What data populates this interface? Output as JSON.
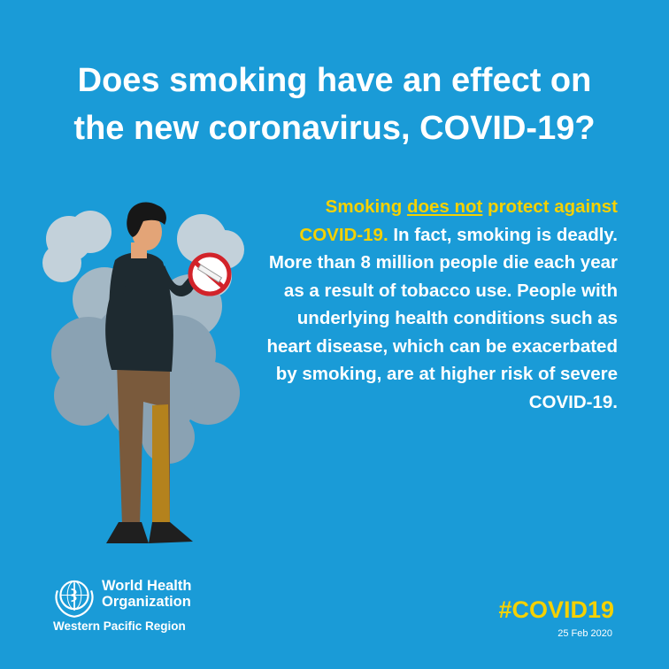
{
  "headline": {
    "line1": "Does smoking have an effect on",
    "line2": "the new coronavirus, COVID-19?"
  },
  "message": {
    "lead_a": "Smoking ",
    "lead_underlined": "does not",
    "lead_b": " protect against COVID-19.",
    "body": " In fact, smoking is deadly. More than 8 million people die each year as a result of tobacco use. People with underlying health conditions such as heart disease, which can be exacerbated by smoking, are at higher risk of severe COVID-19."
  },
  "organization": {
    "name_line1": "World Health",
    "name_line2": "Organization",
    "region": "Western Pacific Region"
  },
  "hashtag": "#COVID19",
  "date": "25 Feb 2020",
  "colors": {
    "background": "#1a9bd7",
    "highlight": "#f5d100",
    "text": "#ffffff",
    "no_smoking_sign": "#d2232a"
  },
  "icons": [
    "person-smoking-illustration",
    "no-smoking-icon",
    "who-emblem-icon"
  ]
}
